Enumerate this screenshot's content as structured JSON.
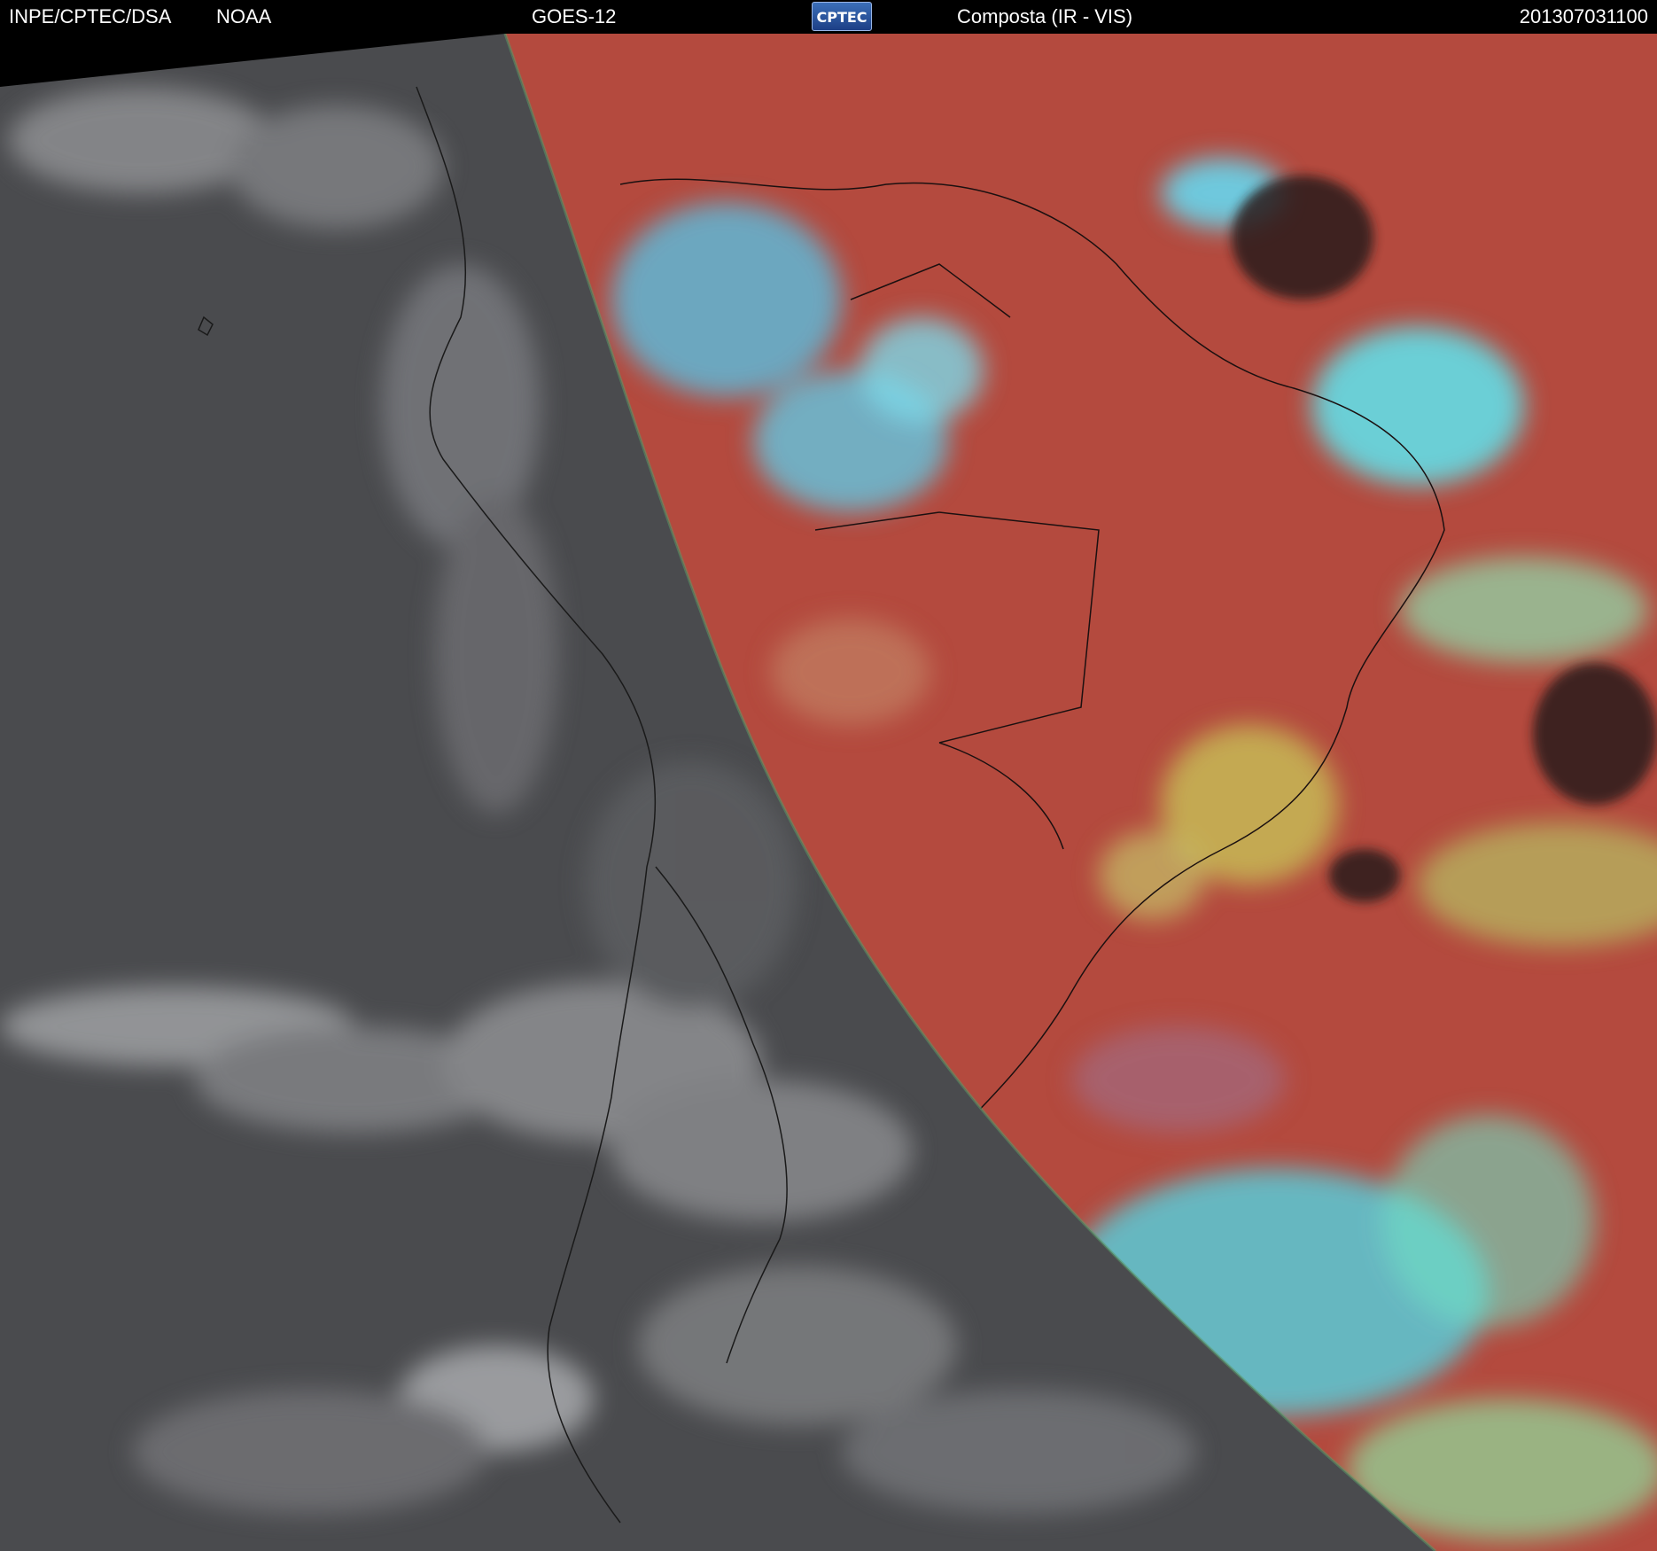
{
  "header": {
    "organization": "INPE/CPTEC/DSA",
    "agency": "NOAA",
    "satellite": "GOES-12",
    "logo_text": "CPTEC",
    "product": "Composta (IR - VIS)",
    "timestamp": "201307031100"
  },
  "colors": {
    "night_gray": "#4b4c4f",
    "day_red": "#b44a3e",
    "cloud_cyan": "#4fe3ef",
    "cloud_yellow": "#c8c85a",
    "background": "#000000"
  }
}
